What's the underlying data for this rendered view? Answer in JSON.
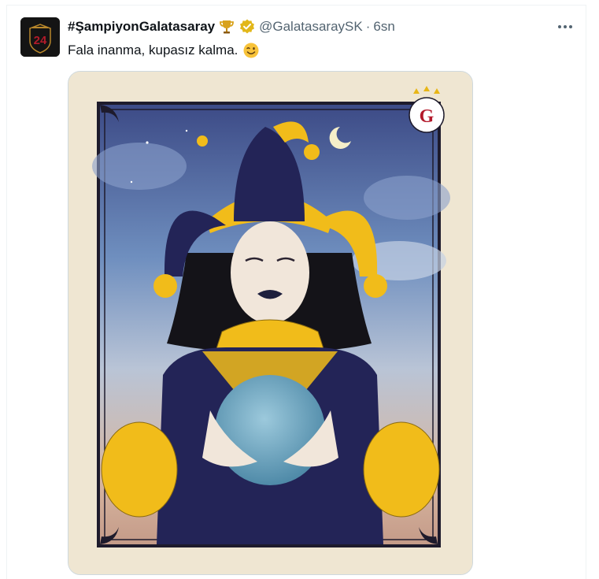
{
  "tweet": {
    "display_name": "#ŞampiyonGalatasaray",
    "handle": "@GalatasaraySK",
    "separator": "·",
    "time": "6sn",
    "text": "Fala inanma, kupasız kalma.",
    "avatar_number": "24",
    "media_icon": "tarot-jester-card-image"
  },
  "icons": {
    "trophy": "trophy-icon",
    "verified": "verified-badge-icon",
    "more": "more-icon",
    "wink": "winking-face-icon"
  },
  "colors": {
    "name": "#0f1419",
    "muted": "#536471",
    "card_bg": "#efe6d2",
    "navy": "#232457",
    "gold": "#f1bc1a"
  }
}
